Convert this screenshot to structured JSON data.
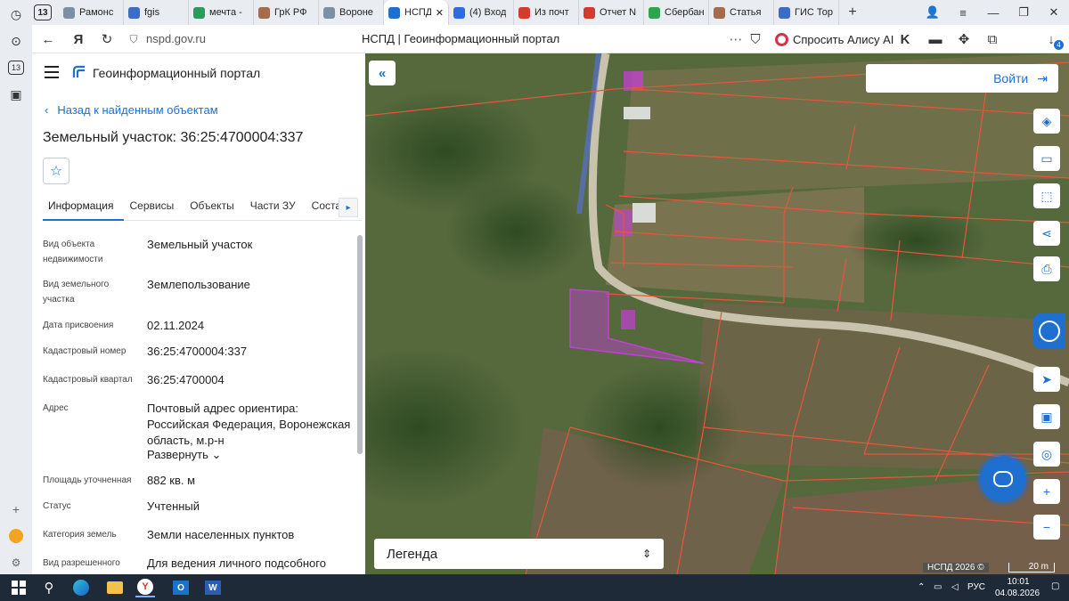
{
  "browser": {
    "tab_count": "13",
    "tabs": [
      {
        "title": "Рамонс",
        "color": "#7c8fa3",
        "icon": "page-icon"
      },
      {
        "title": "fgis",
        "color": "#3c6cc4",
        "icon": "emblem-icon"
      },
      {
        "title": "мечта -",
        "color": "#2c9a5a",
        "icon": "dots-icon"
      },
      {
        "title": "ГрК РФ",
        "color": "#a66a4c",
        "icon": "avatar-icon"
      },
      {
        "title": "Вороне",
        "color": "#7c8fa3",
        "icon": "page-icon"
      },
      {
        "title": "НСПД",
        "color": "#1f6fd1",
        "icon": "nspd-icon",
        "active": true
      },
      {
        "title": "(4) Вход",
        "color": "#2f6be0",
        "icon": "vk-icon"
      },
      {
        "title": "Из почт",
        "color": "#d23b2e",
        "icon": "pdf-icon"
      },
      {
        "title": "Отчет N",
        "color": "#d23b2e",
        "icon": "pdf-icon"
      },
      {
        "title": "Сбербан",
        "color": "#2ea44f",
        "icon": "sber-icon"
      },
      {
        "title": "Статья",
        "color": "#a66a4c",
        "icon": "avatar-icon"
      },
      {
        "title": "ГИС Тор",
        "color": "#3c6cc4",
        "icon": "emblem-icon"
      }
    ],
    "url": "nspd.gov.ru",
    "page_title": "НСПД | Геоинформационный портал",
    "alice_label": "Спросить Алису AI",
    "downloads_badge": "4"
  },
  "panel": {
    "portal_name": "Геоинформационный портал",
    "back_label": "Назад к найденным объектам",
    "object_title": "Земельный участок: 36:25:4700004:337",
    "tabs": [
      "Информация",
      "Сервисы",
      "Объекты",
      "Части ЗУ",
      "Состав"
    ],
    "rows": [
      {
        "key": "Вид объекта недвижимости",
        "value": "Земельный участок"
      },
      {
        "key": "Вид земельного участка",
        "value": "Землепользование"
      },
      {
        "key": "Дата присвоения",
        "value": "02.11.2024"
      },
      {
        "key": "Кадастровый номер",
        "value": "36:25:4700004:337"
      },
      {
        "key": "Кадастровый квартал",
        "value": "36:25:4700004"
      },
      {
        "key": "Адрес",
        "value": "Почтовый адрес ориентира: Российская Федерация, Воронежская область, м.р-н"
      },
      {
        "key": "Площадь уточненная",
        "value": "882 кв. м"
      },
      {
        "key": "Статус",
        "value": "Учтенный"
      },
      {
        "key": "Категория земель",
        "value": "Земли населенных пунктов"
      },
      {
        "key": "Вид разрешенного",
        "value": "Для ведения личного подсобного"
      }
    ],
    "expand_label": "Развернуть"
  },
  "map": {
    "login_label": "Войти",
    "legend_label": "Легенда",
    "copyright": "НСПД 2026 ©",
    "scale_label": "20 m",
    "parcel_color": "#e8553c",
    "selected_color": "#c43fd6"
  },
  "taskbar": {
    "lang": "РУС",
    "time": "10:01",
    "date": "04.08.2026"
  }
}
